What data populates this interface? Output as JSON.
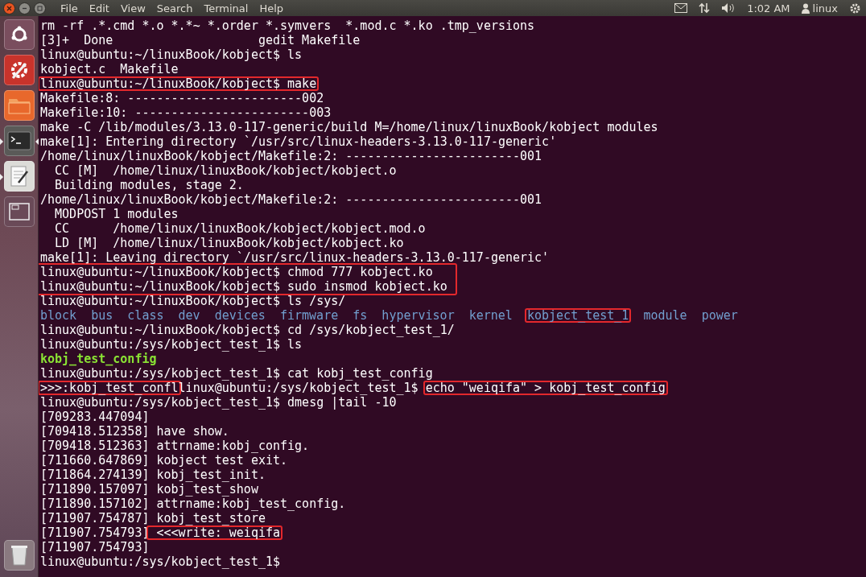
{
  "top_bar": {
    "menus": [
      "File",
      "Edit",
      "View",
      "Search",
      "Terminal",
      "Help"
    ],
    "clock": "1:02 AM",
    "user": "linux"
  },
  "launcher": [
    {
      "kind": "dash",
      "running": false,
      "focused": false
    },
    {
      "kind": "settings",
      "running": false,
      "focused": false
    },
    {
      "kind": "files",
      "running": false,
      "focused": false
    },
    {
      "kind": "terminal",
      "running": true,
      "focused": true
    },
    {
      "kind": "editor",
      "running": true,
      "focused": false
    },
    {
      "kind": "workspaces",
      "running": false,
      "focused": false
    },
    {
      "kind": "trash",
      "running": false,
      "focused": false
    }
  ],
  "terminal": {
    "lines": [
      {
        "segments": [
          {
            "text": "rm -rf .*.cmd *.o *.*~ *.order *.symvers  *.mod.c *.ko .tmp_versions",
            "kind": "plain",
            "boxed": false
          }
        ]
      },
      {
        "segments": [
          {
            "text": "[3]+  Done                    gedit Makefile",
            "kind": "plain",
            "boxed": false
          }
        ]
      },
      {
        "segments": [
          {
            "text": "linux@ubuntu:~/linuxBook/kobject$ ls",
            "kind": "plain",
            "boxed": false
          }
        ]
      },
      {
        "segments": [
          {
            "text": "kobject.c  Makefile",
            "kind": "plain",
            "boxed": false
          }
        ]
      },
      {
        "segments": [
          {
            "text": "linux@ubuntu:~/linuxBook/kobject$ make",
            "kind": "plain",
            "boxed": true
          }
        ]
      },
      {
        "segments": [
          {
            "text": "Makefile:8: ------------------------002",
            "kind": "plain",
            "boxed": false
          }
        ]
      },
      {
        "segments": [
          {
            "text": "Makefile:10: ------------------------003",
            "kind": "plain",
            "boxed": false
          }
        ]
      },
      {
        "segments": [
          {
            "text": "make -C /lib/modules/3.13.0-117-generic/build M=/home/linux/linuxBook/kobject modules",
            "kind": "plain",
            "boxed": false
          }
        ]
      },
      {
        "segments": [
          {
            "text": "make[1]: Entering directory `/usr/src/linux-headers-3.13.0-117-generic'",
            "kind": "plain",
            "boxed": false
          }
        ]
      },
      {
        "segments": [
          {
            "text": "/home/linux/linuxBook/kobject/Makefile:2: ------------------------001",
            "kind": "plain",
            "boxed": false
          }
        ]
      },
      {
        "segments": [
          {
            "text": "  CC [M]  /home/linux/linuxBook/kobject/kobject.o",
            "kind": "plain",
            "boxed": false
          }
        ]
      },
      {
        "segments": [
          {
            "text": "  Building modules, stage 2.",
            "kind": "plain",
            "boxed": false
          }
        ]
      },
      {
        "segments": [
          {
            "text": "/home/linux/linuxBook/kobject/Makefile:2: ------------------------001",
            "kind": "plain",
            "boxed": false
          }
        ]
      },
      {
        "segments": [
          {
            "text": "  MODPOST 1 modules",
            "kind": "plain",
            "boxed": false
          }
        ]
      },
      {
        "segments": [
          {
            "text": "  CC      /home/linux/linuxBook/kobject/kobject.mod.o",
            "kind": "plain",
            "boxed": false
          }
        ]
      },
      {
        "segments": [
          {
            "text": "  LD [M]  /home/linux/linuxBook/kobject/kobject.ko",
            "kind": "plain",
            "boxed": false
          }
        ]
      },
      {
        "segments": [
          {
            "text": "make[1]: Leaving directory `/usr/src/linux-headers-3.13.0-117-generic'",
            "kind": "plain",
            "boxed": false
          }
        ]
      },
      {
        "kind": "boxed_group",
        "lines": [
          {
            "segments": [
              {
                "text": "linux@ubuntu:~/linuxBook/kobject$ chmod 777 kobject.ko",
                "kind": "plain",
                "boxed": false
              }
            ]
          },
          {
            "segments": [
              {
                "text": "linux@ubuntu:~/linuxBook/kobject$ sudo insmod kobject.ko",
                "kind": "plain",
                "boxed": false
              }
            ]
          }
        ]
      },
      {
        "segments": [
          {
            "text": "linux@ubuntu:~/linuxBook/kobject$ ls /sys/",
            "kind": "plain",
            "boxed": false
          }
        ]
      },
      {
        "kind": "columns",
        "segments": [
          {
            "text": "block",
            "kind": "dir",
            "boxed": false
          },
          {
            "text": "bus",
            "kind": "dir",
            "boxed": false
          },
          {
            "text": "class",
            "kind": "dir",
            "boxed": false
          },
          {
            "text": "dev",
            "kind": "dir",
            "boxed": false
          },
          {
            "text": "devices",
            "kind": "dir",
            "boxed": false
          },
          {
            "text": "firmware",
            "kind": "dir",
            "boxed": false
          },
          {
            "text": "fs",
            "kind": "dir",
            "boxed": false
          },
          {
            "text": "hypervisor",
            "kind": "dir",
            "boxed": false
          },
          {
            "text": "kernel",
            "kind": "dir",
            "boxed": false
          },
          {
            "text": "kobject_test_1",
            "kind": "dir",
            "boxed": true
          },
          {
            "text": "module",
            "kind": "dir",
            "boxed": false
          },
          {
            "text": "power",
            "kind": "dir",
            "boxed": false
          }
        ]
      },
      {
        "segments": [
          {
            "text": "linux@ubuntu:~/linuxBook/kobject$ cd /sys/kobject_test_1/",
            "kind": "plain",
            "boxed": false
          }
        ]
      },
      {
        "segments": [
          {
            "text": "linux@ubuntu:/sys/kobject_test_1$ ls",
            "kind": "plain",
            "boxed": false
          }
        ]
      },
      {
        "segments": [
          {
            "text": "kobj_test_config",
            "kind": "file",
            "boxed": false
          }
        ]
      },
      {
        "segments": [
          {
            "text": "linux@ubuntu:/sys/kobject_test_1$ cat kobj_test_config",
            "kind": "plain",
            "boxed": false
          }
        ]
      },
      {
        "segments": [
          {
            "text": ">>>:kobj_test_confl",
            "kind": "plain",
            "boxed": true
          },
          {
            "text": "linux@ubuntu:/sys/kobject_test_1$ ",
            "kind": "plain",
            "boxed": false
          },
          {
            "text": "echo \"weiqifa\" > kobj_test_config",
            "kind": "plain",
            "boxed": true
          }
        ]
      },
      {
        "segments": [
          {
            "text": "linux@ubuntu:/sys/kobject_test_1$ dmesg |tail -10",
            "kind": "plain",
            "boxed": false
          }
        ]
      },
      {
        "segments": [
          {
            "text": "[709283.447094]",
            "kind": "plain",
            "boxed": false
          }
        ]
      },
      {
        "segments": [
          {
            "text": "[709418.512358] have show.",
            "kind": "plain",
            "boxed": false
          }
        ]
      },
      {
        "segments": [
          {
            "text": "[709418.512363] attrname:kobj_config.",
            "kind": "plain",
            "boxed": false
          }
        ]
      },
      {
        "segments": [
          {
            "text": "[711660.647869] kobject test exit.",
            "kind": "plain",
            "boxed": false
          }
        ]
      },
      {
        "segments": [
          {
            "text": "[711864.274139] kobj_test_init.",
            "kind": "plain",
            "boxed": false
          }
        ]
      },
      {
        "segments": [
          {
            "text": "[711890.157097] kobj_test_show",
            "kind": "plain",
            "boxed": false
          }
        ]
      },
      {
        "segments": [
          {
            "text": "[711890.157102] attrname:kobj_test_config.",
            "kind": "plain",
            "boxed": false
          }
        ]
      },
      {
        "segments": [
          {
            "text": "[711907.754787] kobj_test_store",
            "kind": "plain",
            "boxed": false
          }
        ]
      },
      {
        "segments": [
          {
            "text": "[711907.754793]",
            "kind": "plain",
            "boxed": false
          },
          {
            "text": " <<<write: weiqifa",
            "kind": "plain",
            "boxed": true
          }
        ]
      },
      {
        "segments": [
          {
            "text": "[711907.754793]",
            "kind": "plain",
            "boxed": false
          }
        ]
      },
      {
        "segments": [
          {
            "text": "linux@ubuntu:/sys/kobject_test_1$",
            "kind": "plain",
            "boxed": false
          }
        ]
      }
    ]
  }
}
